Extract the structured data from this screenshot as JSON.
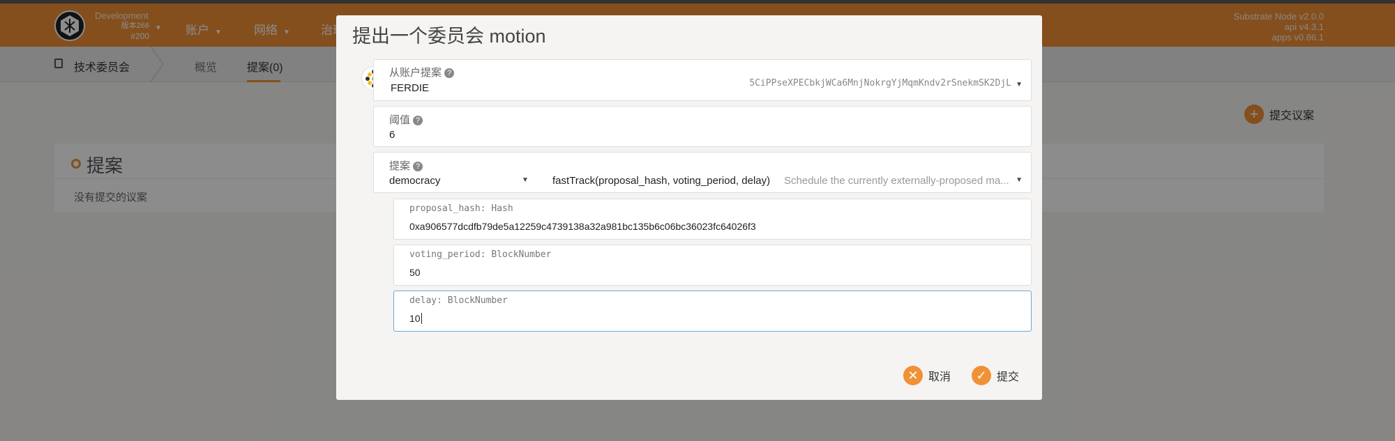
{
  "topbar": {
    "chain_name": "Development",
    "chain_version": "版本266",
    "block": "#200",
    "nav": [
      "账户",
      "网络",
      "治理"
    ],
    "node_info": [
      "Substrate Node v2.0.0",
      "api v4.3.1",
      "apps v0.86.1"
    ]
  },
  "subbar": {
    "title": "技术委员会",
    "tabs": [
      "概览",
      "提案(0)"
    ]
  },
  "page": {
    "submit_proposal": "提交议案",
    "card_title": "提案",
    "empty_text": "没有提交的议案"
  },
  "modal": {
    "title": "提出一个委员会 motion",
    "account": {
      "label": "从账户提案",
      "name": "FERDIE",
      "address": "5CiPPseXPECbkjWCa6MnjNokrgYjMqmKndv2rSnekmSK2DjL"
    },
    "threshold": {
      "label": "阈值",
      "value": "6"
    },
    "proposal": {
      "label": "提案",
      "module": "democracy",
      "method": "fastTrack(proposal_hash, voting_period, delay)",
      "description": "Schedule the currently externally-proposed ma..."
    },
    "params": [
      {
        "label": "proposal_hash: Hash",
        "value": "0xa906577dcdfb79de5a12259c4739138a32a981bc135b6c06bc36023fc64026f3"
      },
      {
        "label": "voting_period: BlockNumber",
        "value": "50"
      },
      {
        "label": "delay: BlockNumber",
        "value": "10"
      }
    ],
    "buttons": {
      "cancel": "取消",
      "submit": "提交"
    }
  },
  "colors": {
    "accent": "#f19135",
    "focus": "#6fa7d8"
  }
}
